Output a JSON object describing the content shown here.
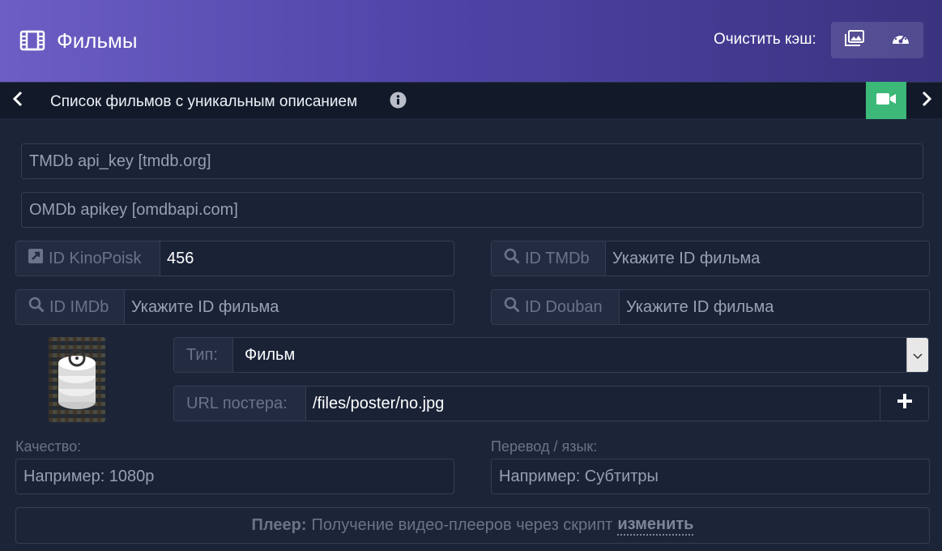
{
  "header": {
    "title": "Фильмы",
    "title_icon": "film-icon",
    "cache_label": "Очистить кэш:",
    "cache_buttons": [
      {
        "icon": "images-icon"
      },
      {
        "icon": "gauge-icon"
      }
    ]
  },
  "subbar": {
    "title": "Список фильмов с уникальным описанием",
    "info_icon": "info-icon",
    "camera_icon": "video-camera-icon"
  },
  "form": {
    "tmdb_key_placeholder": "TMDb api_key [tmdb.org]",
    "omdb_key_placeholder": "OMDb apikey [omdbapi.com]",
    "id_kinopoisk": {
      "label": "ID KinoPoisk",
      "value": "456"
    },
    "id_tmdb": {
      "label": "ID TMDb",
      "placeholder": "Укажите ID фильма"
    },
    "id_imdb": {
      "label": "ID IMDb",
      "placeholder": "Укажите ID фильма"
    },
    "id_douban": {
      "label": "ID Douban",
      "placeholder": "Укажите ID фильма"
    },
    "type": {
      "label": "Тип:",
      "value": "Фильм"
    },
    "poster_url": {
      "label": "URL постера:",
      "value": "/files/poster/no.jpg"
    },
    "quality": {
      "label": "Качество:",
      "placeholder": "Например: 1080p"
    },
    "translation": {
      "label": "Перевод / язык:",
      "placeholder": "Например: Субтитры"
    }
  },
  "player": {
    "label": "Плеер:",
    "text": "Получение видео-плееров через скрипт",
    "link": "изменить"
  },
  "colors": {
    "header_start": "#6c5ec4",
    "header_end": "#3a337f",
    "accent_green": "#3cb878",
    "background": "#1c2538"
  }
}
